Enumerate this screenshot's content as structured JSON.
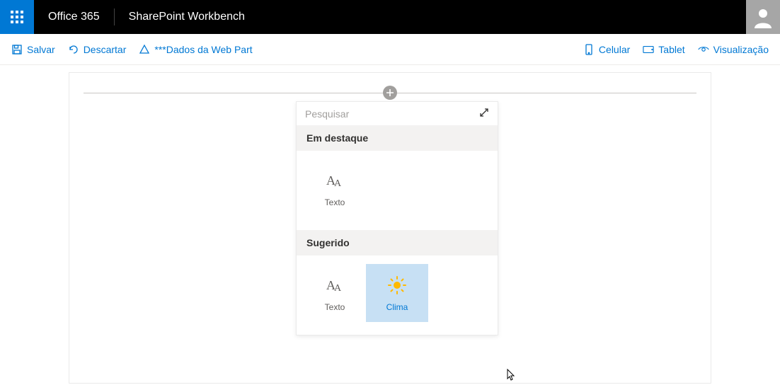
{
  "suite": {
    "brand": "Office 365",
    "app": "SharePoint Workbench"
  },
  "commands": {
    "save": "Salvar",
    "discard": "Descartar",
    "webpart_data": "***Dados da Web Part",
    "mobile": "Celular",
    "tablet": "Tablet",
    "preview": "Visualização"
  },
  "toolbox": {
    "search_placeholder": "Pesquisar",
    "groups": [
      {
        "header": "Em destaque",
        "items": [
          {
            "label": "Texto",
            "icon": "text"
          }
        ]
      },
      {
        "header": "Sugerido",
        "items": [
          {
            "label": "Texto",
            "icon": "text"
          },
          {
            "label": "Clima",
            "icon": "weather",
            "selected": true
          }
        ]
      }
    ]
  }
}
